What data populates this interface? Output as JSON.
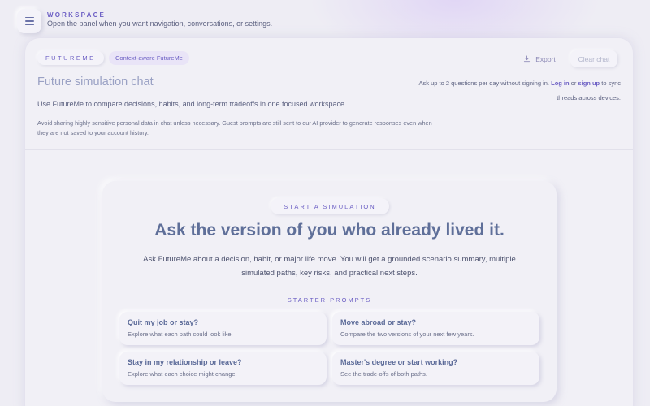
{
  "topbar": {
    "menu_icon": "hamburger-icon",
    "workspace_label": "WORKSPACE",
    "workspace_hint": "Open the panel when you want navigation, conversations, or settings."
  },
  "header": {
    "brand": "FUTUREME",
    "context_tag": "Context-aware FutureMe",
    "title": "Future simulation chat",
    "intro": "Use FutureMe to compare decisions, habits, and long-term tradeoffs in one focused workspace.",
    "privacy_note": "Avoid sharing highly sensitive personal data in chat unless necessary. Guest prompts are still sent to our AI provider to generate responses even when they are not saved to your account history.",
    "export_label": "Export",
    "export_icon": "download-icon",
    "clear_label": "Clear chat",
    "signin_prefix": "Ask up to 2 questions per day without signing in.",
    "login_link": "Log in",
    "or_text": "or",
    "signup_link": "sign up",
    "signin_suffix": "to sync threads across devices."
  },
  "hero": {
    "badge": "START A SIMULATION",
    "headline": "Ask the version of you who already lived it.",
    "description": "Ask FutureMe about a decision, habit, or major life move. You will get a grounded scenario summary, multiple simulated paths, key risks, and practical next steps.",
    "starter_label": "STARTER PROMPTS",
    "prompts": [
      {
        "title": "Quit my job or stay?",
        "subtitle": "Explore what each path could look like."
      },
      {
        "title": "Move abroad or stay?",
        "subtitle": "Compare the two versions of your next few years."
      },
      {
        "title": "Stay in my relationship or leave?",
        "subtitle": "Explore what each choice might change."
      },
      {
        "title": "Master's degree or start working?",
        "subtitle": "See the trade-offs of both paths."
      }
    ]
  },
  "colors": {
    "accent": "#6c5fc4",
    "background": "#eeedf4",
    "headline": "#5f6f99"
  }
}
